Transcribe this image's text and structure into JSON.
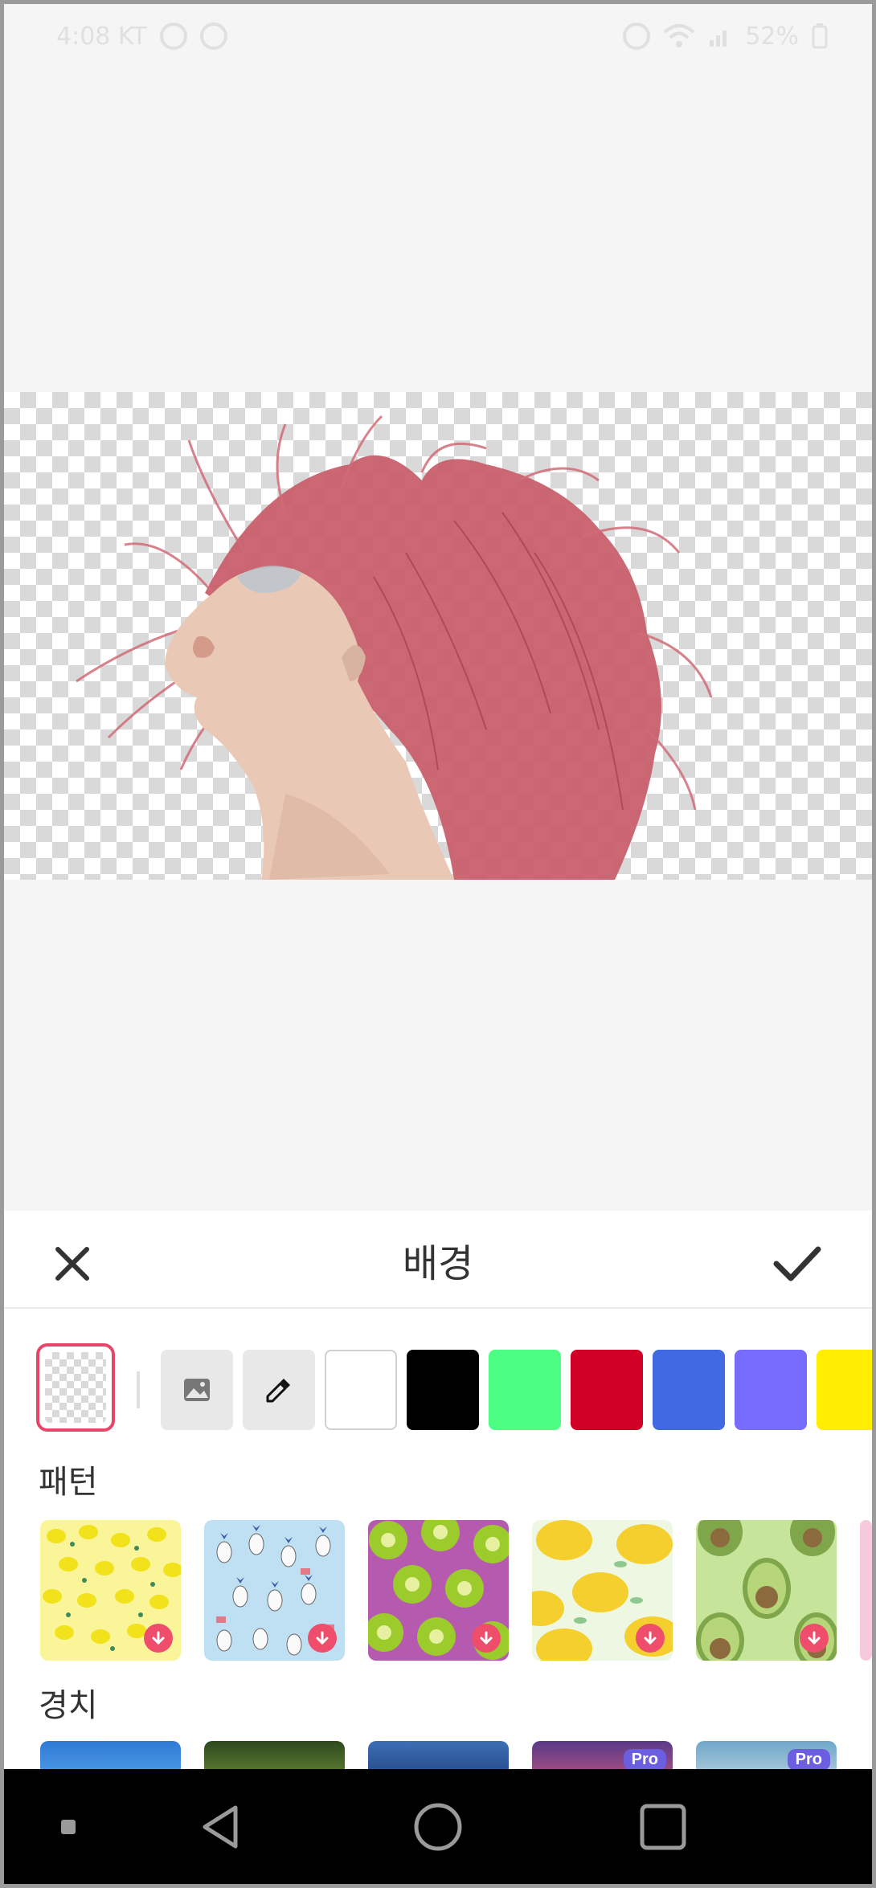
{
  "status_bar": {
    "time_carrier": "4:08 KT",
    "battery": "52%"
  },
  "sheet": {
    "title": "배경"
  },
  "colors": {
    "accent": "#e8456b",
    "swatches": [
      "#ffffff",
      "#000000",
      "#4cff83",
      "#d10025",
      "#4169e1",
      "#786cff",
      "#ffee00"
    ]
  },
  "sections": {
    "pattern_label": "패턴",
    "scenery_label": "경치"
  },
  "patterns": [
    {
      "name": "lemon-pattern"
    },
    {
      "name": "pineapple-pattern"
    },
    {
      "name": "kiwi-pattern"
    },
    {
      "name": "big-lemon-pattern"
    },
    {
      "name": "avocado-pattern"
    }
  ],
  "scenery": {
    "pro_label": "Pro"
  },
  "icons": {
    "close": "close-icon",
    "confirm": "checkmark-icon",
    "gallery": "image-icon",
    "eyedropper": "eyedropper-icon",
    "download": "download-icon"
  }
}
